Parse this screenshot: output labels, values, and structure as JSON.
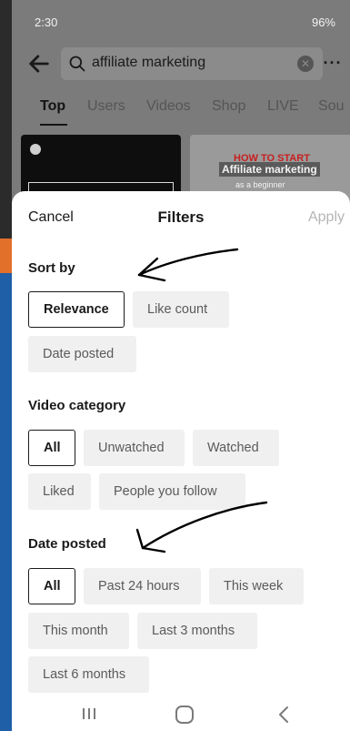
{
  "status_bar": {
    "time": "2:30",
    "right_text": "96%"
  },
  "search": {
    "query": "affiliate marketing"
  },
  "tabs": [
    "Top",
    "Users",
    "Videos",
    "Shop",
    "LIVE",
    "Sou"
  ],
  "thumbnails": {
    "second": {
      "headline": "HOW TO START",
      "title": "Affiliate marketing",
      "subtitle": "as a beginner"
    }
  },
  "sheet": {
    "cancel": "Cancel",
    "title": "Filters",
    "apply": "Apply",
    "sections": {
      "sort_by": {
        "title": "Sort by",
        "options": [
          "Relevance",
          "Like count",
          "Date posted"
        ],
        "selected": "Relevance"
      },
      "video_category": {
        "title": "Video category",
        "options": [
          "All",
          "Unwatched",
          "Watched",
          "Liked",
          "People you follow"
        ],
        "selected": "All"
      },
      "date_posted": {
        "title": "Date posted",
        "options": [
          "All",
          "Past 24 hours",
          "This week",
          "This month",
          "Last 3 months",
          "Last 6 months"
        ],
        "selected": "All"
      }
    }
  },
  "icons": [
    "back-arrow-icon",
    "search-icon",
    "clear-icon",
    "more-icon",
    "recent-apps-icon",
    "home-icon",
    "back-icon"
  ]
}
